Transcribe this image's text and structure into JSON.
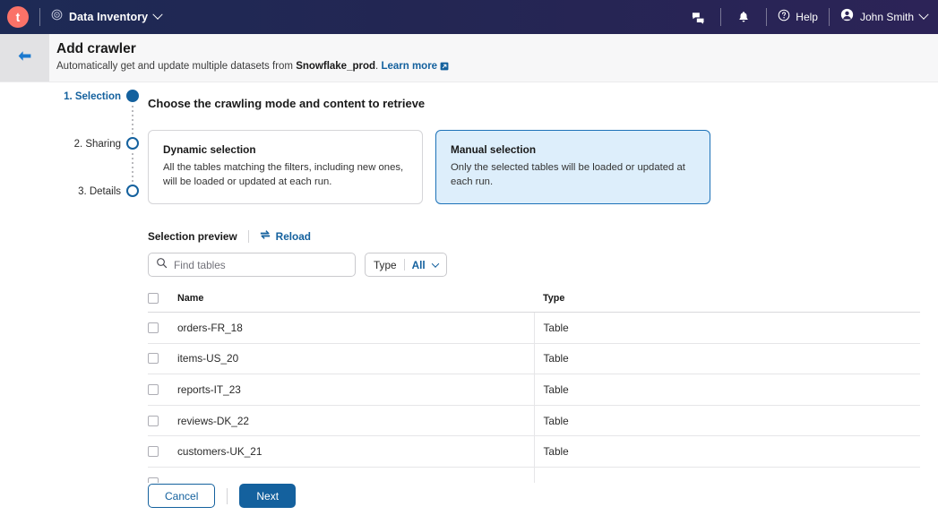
{
  "topbar": {
    "logo_letter": "t",
    "logo_color": "#fa7268",
    "app_icon": "target-icon",
    "app_name": "Data Inventory",
    "chat_icon": "chat-icon",
    "notifications_icon": "bell-icon",
    "help_icon": "help-circle-icon",
    "help_label": "Help",
    "avatar_icon": "avatar-icon",
    "user_name": "John Smith"
  },
  "header": {
    "back_icon": "back-arrow-icon",
    "title": "Add crawler",
    "subtitle_prefix": "Automatically get and update multiple datasets from ",
    "subtitle_source": "Snowflake_prod",
    "subtitle_suffix": ".",
    "learn_more": "Learn more",
    "external_link_icon": "external-link-icon"
  },
  "stepper": {
    "steps": [
      {
        "label": "1. Selection",
        "state": "active"
      },
      {
        "label": "2. Sharing",
        "state": "pending"
      },
      {
        "label": "3. Details",
        "state": "pending"
      }
    ]
  },
  "main": {
    "section_title": "Choose the crawling mode and content to retrieve",
    "modes": [
      {
        "title": "Dynamic selection",
        "description": "All the tables matching the filters, including new ones, will be loaded or updated at each run.",
        "selected": false
      },
      {
        "title": "Manual selection",
        "description": "Only the selected tables will be loaded or updated at each run.",
        "selected": true
      }
    ],
    "preview": {
      "label": "Selection preview",
      "reload_icon": "refresh-icon",
      "reload_label": "Reload"
    },
    "filters": {
      "search_icon": "search-icon",
      "search_value": "",
      "search_placeholder": "Find tables",
      "type_label": "Type",
      "type_value": "All",
      "type_chevron_icon": "chevron-down-icon"
    },
    "table": {
      "columns": [
        "Name",
        "Type"
      ],
      "rows": [
        {
          "name": "orders-FR_18",
          "type": "Table",
          "checked": false
        },
        {
          "name": "items-US_20",
          "type": "Table",
          "checked": false
        },
        {
          "name": "reports-IT_23",
          "type": "Table",
          "checked": false
        },
        {
          "name": "reviews-DK_22",
          "type": "Table",
          "checked": false
        },
        {
          "name": "customers-UK_21",
          "type": "Table",
          "checked": false
        }
      ]
    }
  },
  "footer": {
    "cancel_label": "Cancel",
    "next_label": "Next"
  },
  "colors": {
    "accent": "#14619e",
    "header_start": "#1d2a55",
    "header_end": "#2c2357",
    "selected_card_bg": "#ddeefb"
  }
}
